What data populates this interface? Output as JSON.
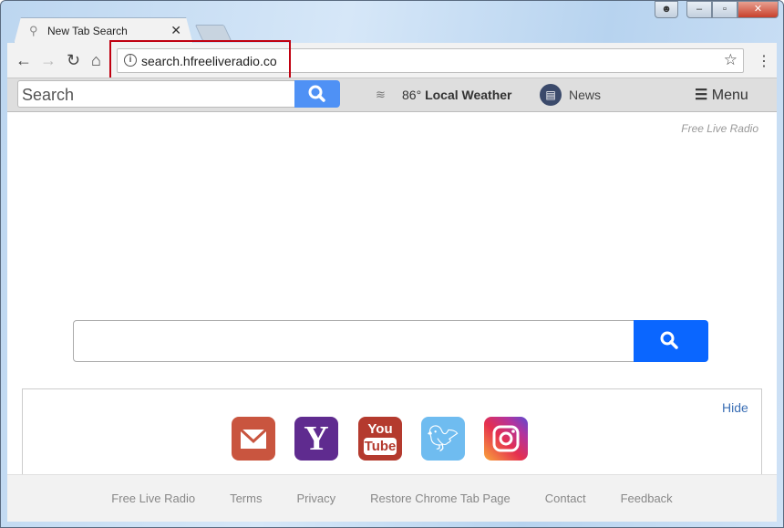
{
  "browser": {
    "tab_title": "New Tab Search",
    "url": "search.hfreeliveradio.co"
  },
  "topbar": {
    "search_placeholder": "Search",
    "temperature": "86°",
    "weather_label": "Local Weather",
    "news_label": "News",
    "menu_label": "Menu"
  },
  "brand": "Free Live Radio",
  "tiles": {
    "hide_label": "Hide",
    "items": [
      {
        "name": "Gmail",
        "color": "#c9553f"
      },
      {
        "name": "Yahoo",
        "color": "#5f2b8f"
      },
      {
        "name": "YouTube",
        "color": "#b43a2e"
      },
      {
        "name": "Twitter",
        "color": "#6fbcf0"
      },
      {
        "name": "Instagram",
        "color": "#c53a8a"
      }
    ],
    "youtube_text": [
      "You",
      "Tube"
    ],
    "yahoo_text": "Y"
  },
  "footer": {
    "links": [
      "Free Live Radio",
      "Terms",
      "Privacy",
      "Restore Chrome Tab Page",
      "Contact",
      "Feedback"
    ]
  }
}
